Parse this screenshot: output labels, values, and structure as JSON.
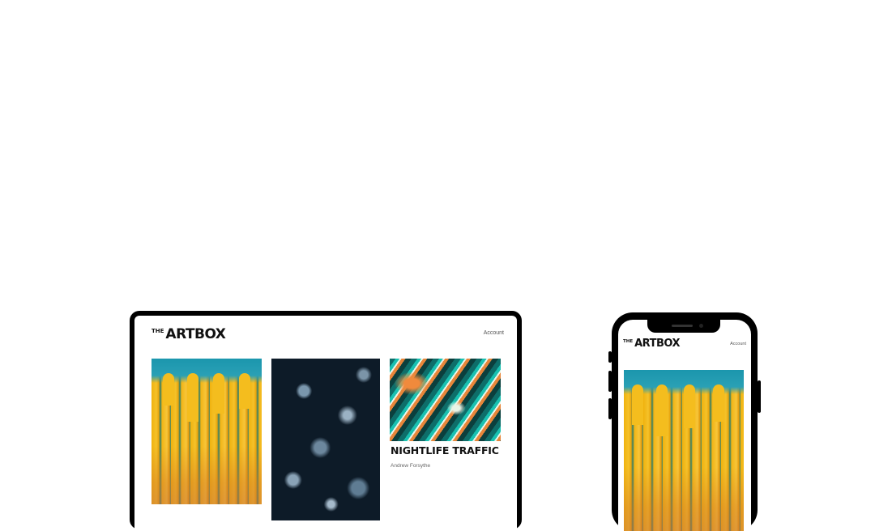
{
  "desktop": {
    "brand_prefix": "THE",
    "brand_name": "ARTBOX",
    "account_label": "Account",
    "cards": [
      {
        "title": "",
        "author": "",
        "art": "yellow-drip-painting"
      },
      {
        "title": "",
        "author": "",
        "art": "dark-blue-marble"
      },
      {
        "title": "NIGHTLIFE TRAFFIC",
        "author": "Andrew Forsythe",
        "art": "teal-orange-fluid-art"
      }
    ]
  },
  "phone": {
    "brand_prefix": "THE",
    "brand_name": "ARTBOX",
    "account_label": "Account",
    "hero_art": "yellow-drip-painting"
  },
  "colors": {
    "background": "#ffffff",
    "device_frame": "#000000",
    "text": "#111111"
  }
}
